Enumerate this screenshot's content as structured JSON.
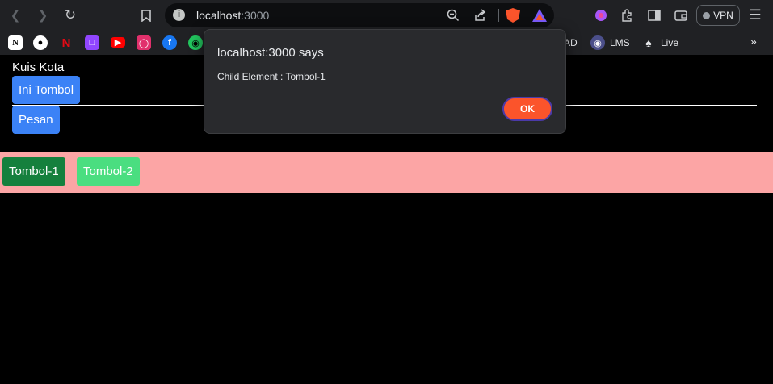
{
  "browser": {
    "url_host": "localhost",
    "url_port": ":3000",
    "vpn_label": "VPN"
  },
  "bookmarks": [
    {
      "icon": "notion-icon",
      "label": ""
    },
    {
      "icon": "github-icon",
      "label": ""
    },
    {
      "icon": "netflix-icon",
      "label": ""
    },
    {
      "icon": "twitch-icon",
      "label": ""
    },
    {
      "icon": "youtube-icon",
      "label": ""
    },
    {
      "icon": "instagram-icon",
      "label": ""
    },
    {
      "icon": "facebook-icon",
      "label": ""
    },
    {
      "icon": "extension-icon",
      "label": ""
    },
    {
      "icon": "",
      "label": "AD"
    },
    {
      "icon": "lms-icon",
      "label": "LMS"
    },
    {
      "icon": "live-icon",
      "label": "Live"
    }
  ],
  "page": {
    "title": "Kuis Kota",
    "button_primary": "Ini Tombol",
    "button_message": "Pesan",
    "tombol_1": "Tombol-1",
    "tombol_2": "Tombol-2"
  },
  "dialog": {
    "title": "localhost:3000 says",
    "message": "Child Element : Tombol-1",
    "ok_label": "OK"
  },
  "colors": {
    "primary_blue": "#3b82f6",
    "tombol_1_green": "#15803d",
    "tombol_2_green": "#4ade80",
    "pink_bar": "#fca5a5",
    "ok_orange": "#fb542b"
  }
}
